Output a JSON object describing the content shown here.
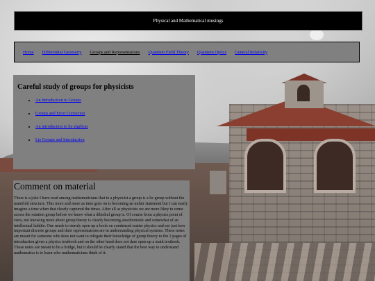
{
  "header": {
    "title": "Physical and Mathematical musings"
  },
  "nav": {
    "items": [
      {
        "label": "Home",
        "current": false
      },
      {
        "label": "Differential Geometry",
        "current": false
      },
      {
        "label": "Groups and Representations",
        "current": true
      },
      {
        "label": "Quantum Field Theory",
        "current": false
      },
      {
        "label": "Quantum Optics",
        "current": false
      },
      {
        "label": "General Relativity",
        "current": false
      }
    ]
  },
  "groups_panel": {
    "heading": "Careful study of groups for physicists",
    "links": [
      "An Introduction to Groups",
      "Groups and Error Correction",
      "An introduction to lie algebras",
      "Lie Groups and Introduction"
    ]
  },
  "comment_panel": {
    "heading": "Comment on material",
    "body": "There is a joke I have read among mathematicians that to a physicist a group is a lie group without the manifold structure. This more and more as time goes on is becoming an unfair statement but I can easily imagine a time when that clearly captured the times. After all as physicists we are more likey to come across the rotation group before we know what a dihedral group is. Of course from a physics point of view, not knowing more about group theory is clearly becoming anachronistic and somewhat of an intellectual laddite. One needs to sternly open up a book on condensed matter physics and see just how important discrete groups and their representations are in understanding physical systems. These notes are meant for someone who does not want to relegate their knowledge of group theory to the 2 pages of introduction given a physics textbook and on the other hand does not dare open up a math textbook. These notes are meant to be a bridge, but it should be clearly stated that the best way to understand mathematics is to learn who mathematicians think of it."
  }
}
